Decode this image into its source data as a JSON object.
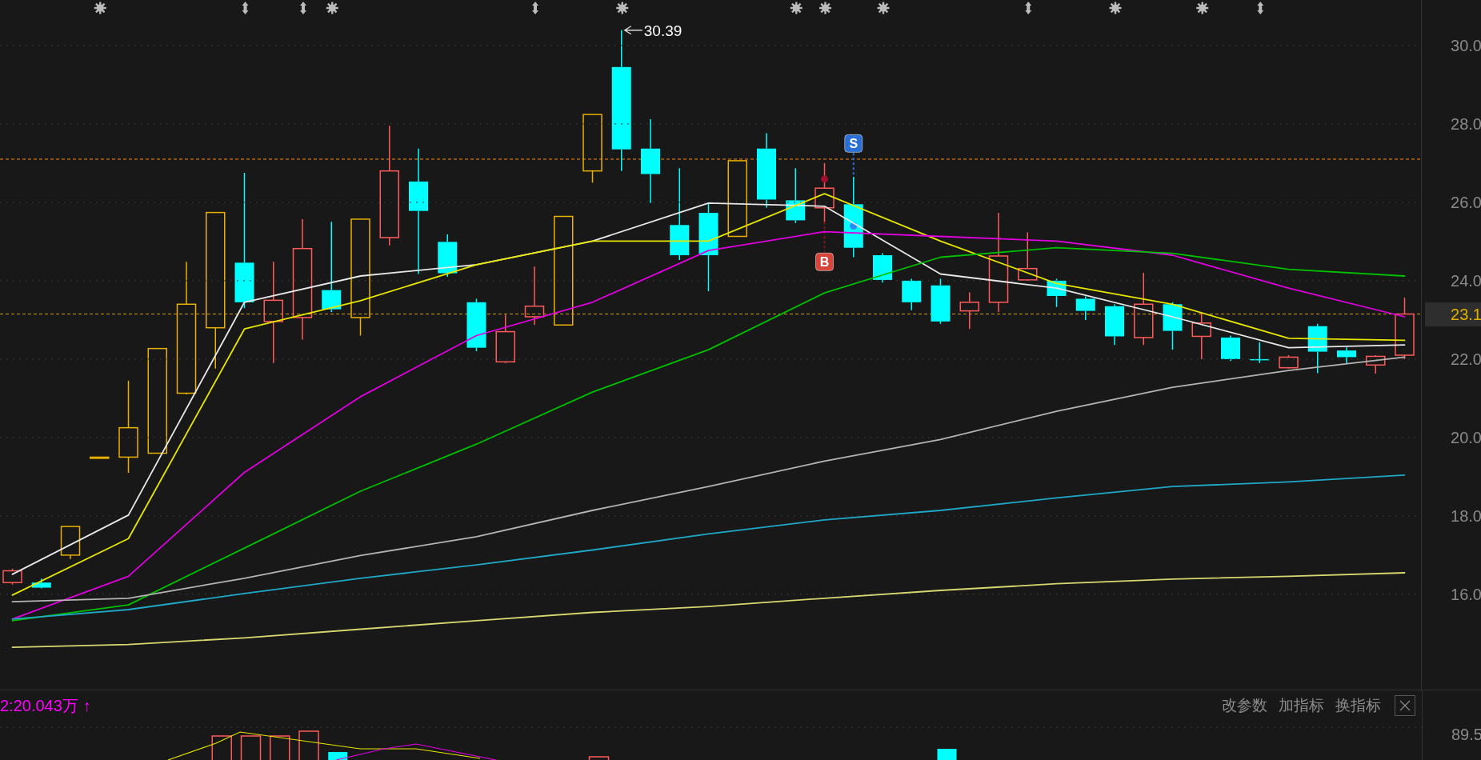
{
  "price_chart": {
    "chart_data": {
      "type": "line",
      "grid": true,
      "ylim": [
        13.57,
        31.16
      ],
      "yticks": [
        {
          "value": 30,
          "label": "30.0"
        },
        {
          "value": 28,
          "label": "28.0"
        },
        {
          "value": 26,
          "label": "26.0"
        },
        {
          "value": 24,
          "label": "24.0"
        },
        {
          "value": 22,
          "label": "22.0"
        },
        {
          "value": 20,
          "label": "20.0"
        },
        {
          "value": 18,
          "label": "18.0"
        },
        {
          "value": 16,
          "label": "16.0"
        }
      ],
      "series": [
        {
          "color": "#e8e8e8",
          "values": [
            16.51,
            null,
            null,
            null,
            18.02,
            null,
            null,
            null,
            23.45,
            null,
            null,
            null,
            24.12,
            null,
            null,
            null,
            24.41,
            null,
            null,
            null,
            25.01,
            null,
            null,
            null,
            25.98,
            null,
            null,
            null,
            25.9,
            null,
            null,
            null,
            24.17,
            null,
            null,
            null,
            23.81,
            null,
            null,
            null,
            23.08,
            null,
            null,
            null,
            22.29,
            null,
            null,
            null,
            22.36
          ]
        },
        {
          "color": "#e6e600",
          "values": [
            15.98,
            null,
            null,
            null,
            17.42,
            null,
            null,
            null,
            22.77,
            null,
            null,
            null,
            23.49,
            null,
            null,
            null,
            24.41,
            null,
            null,
            null,
            25.01,
            null,
            null,
            null,
            25.01,
            null,
            null,
            null,
            26.22,
            null,
            null,
            null,
            25.01,
            null,
            null,
            null,
            23.93,
            null,
            null,
            null,
            23.4,
            null,
            null,
            null,
            22.53,
            null,
            null,
            null,
            22.48
          ]
        },
        {
          "color": "#e000e0",
          "values": [
            15.37,
            null,
            null,
            null,
            16.46,
            null,
            null,
            null,
            19.11,
            null,
            null,
            null,
            21.04,
            null,
            null,
            null,
            22.6,
            null,
            null,
            null,
            23.45,
            null,
            null,
            null,
            24.77,
            null,
            null,
            null,
            25.25,
            null,
            null,
            null,
            25.13,
            null,
            null,
            null,
            25.01,
            null,
            null,
            null,
            24.65,
            null,
            null,
            null,
            23.81,
            null,
            null,
            null,
            23.08
          ]
        },
        {
          "color": "#00c000",
          "values": [
            15.33,
            null,
            null,
            null,
            15.73,
            null,
            null,
            null,
            17.18,
            null,
            null,
            null,
            18.63,
            null,
            null,
            null,
            19.83,
            null,
            null,
            null,
            21.16,
            null,
            null,
            null,
            22.24,
            null,
            null,
            null,
            23.69,
            null,
            null,
            null,
            24.6,
            null,
            null,
            null,
            24.84,
            null,
            null,
            null,
            24.7,
            null,
            null,
            null,
            24.29,
            null,
            null,
            null,
            24.12
          ]
        },
        {
          "color": "#b4b4b4",
          "values": [
            15.81,
            null,
            null,
            null,
            15.9,
            null,
            null,
            null,
            16.41,
            null,
            null,
            null,
            16.99,
            null,
            null,
            null,
            17.47,
            null,
            null,
            null,
            18.14,
            null,
            null,
            null,
            18.75,
            null,
            null,
            null,
            19.4,
            null,
            null,
            null,
            19.95,
            null,
            null,
            null,
            20.67,
            null,
            null,
            null,
            21.28,
            null,
            null,
            null,
            21.71,
            null,
            null,
            null,
            22.05
          ]
        },
        {
          "color": "#1fa8c8",
          "values": [
            15.37,
            null,
            null,
            null,
            15.61,
            null,
            null,
            null,
            16.02,
            null,
            null,
            null,
            16.41,
            null,
            null,
            null,
            16.75,
            null,
            null,
            null,
            17.13,
            null,
            null,
            null,
            17.54,
            null,
            null,
            null,
            17.9,
            null,
            null,
            null,
            18.14,
            null,
            null,
            null,
            18.46,
            null,
            null,
            null,
            18.75,
            null,
            null,
            null,
            18.87,
            null,
            null,
            null,
            19.04
          ]
        },
        {
          "color": "#d8d870",
          "values": [
            14.65,
            null,
            null,
            null,
            14.72,
            null,
            null,
            null,
            14.89,
            null,
            null,
            null,
            15.11,
            null,
            null,
            null,
            15.33,
            null,
            null,
            null,
            15.54,
            null,
            null,
            null,
            15.69,
            null,
            null,
            null,
            15.9,
            null,
            null,
            null,
            16.1,
            null,
            null,
            null,
            16.27,
            null,
            null,
            null,
            16.39,
            null,
            null,
            null,
            16.46,
            null,
            null,
            null,
            16.55
          ]
        }
      ]
    },
    "high_label": "30.39",
    "signals": [
      {
        "kind": "buy",
        "text": "B"
      },
      {
        "kind": "sell",
        "text": "S"
      }
    ],
    "current_price": "23.1"
  },
  "volume_panel": {
    "reading": "2:20.043万 ↑",
    "buttons": [
      "改参数",
      "加指标",
      "换指标"
    ],
    "axis_label": "89.5"
  }
}
